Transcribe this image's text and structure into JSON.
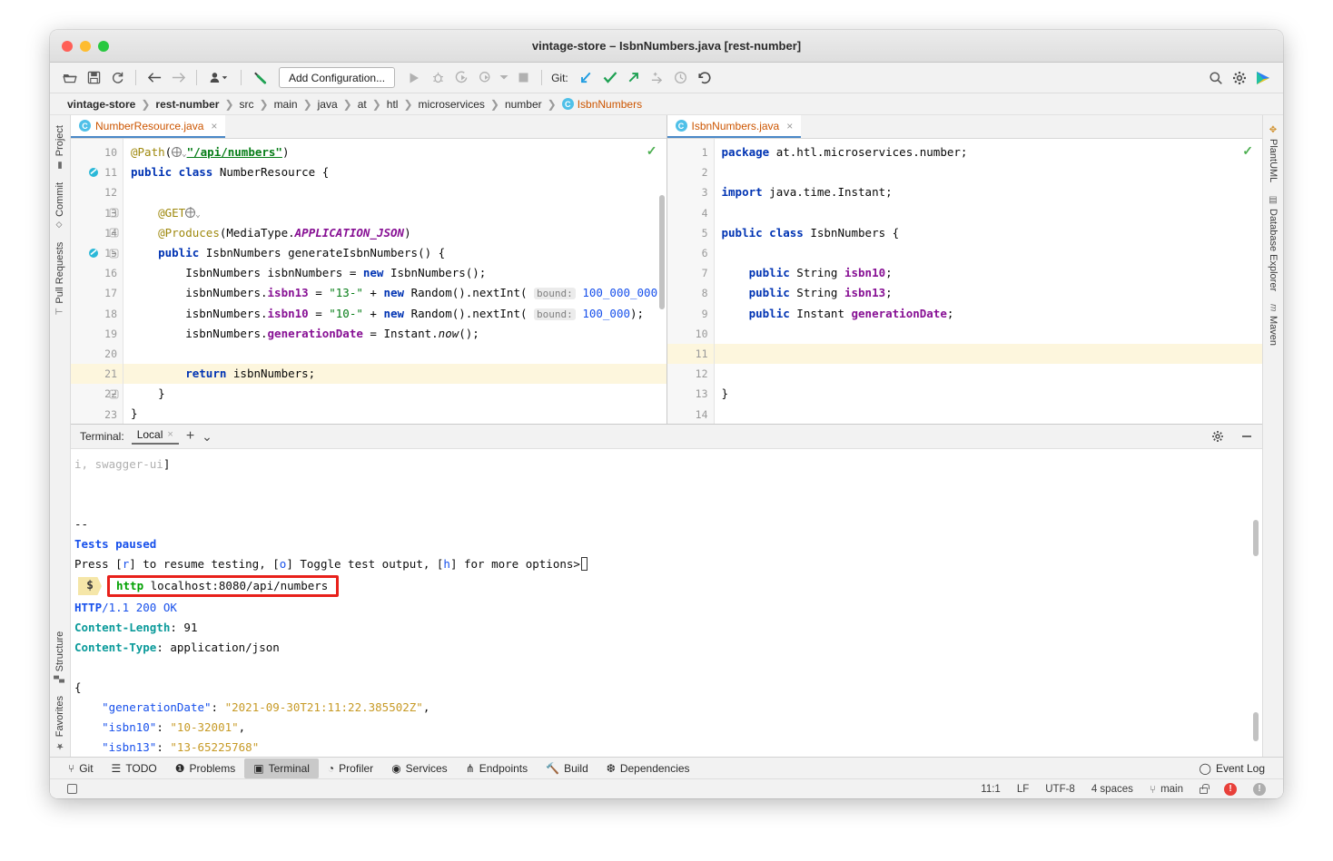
{
  "window": {
    "title": "vintage-store – IsbnNumbers.java [rest-number]"
  },
  "toolbar": {
    "add_configuration_label": "Add Configuration...",
    "git_label": "Git:",
    "icons": [
      "open-folder-icon",
      "save-icon",
      "sync-icon",
      "back-arrow-icon",
      "forward-arrow-icon",
      "profile-dropdown-icon",
      "build-hammer-icon"
    ],
    "run_icons": [
      "run-icon",
      "debug-icon",
      "run-coverage-icon",
      "profile-icon",
      "dropdown-icon",
      "stop-icon"
    ],
    "git_icons": [
      "update-project-icon",
      "commit-icon",
      "push-icon",
      "rebase-icon",
      "history-icon",
      "rollback-icon"
    ],
    "right_icons": [
      "search-icon",
      "gear-icon",
      "ide-logo-icon"
    ]
  },
  "breadcrumb": {
    "items": [
      {
        "label": "vintage-store",
        "bold": true
      },
      {
        "label": "rest-number",
        "bold": true
      },
      {
        "label": "src",
        "bold": false
      },
      {
        "label": "main",
        "bold": false
      },
      {
        "label": "java",
        "bold": false
      },
      {
        "label": "at",
        "bold": false
      },
      {
        "label": "htl",
        "bold": false
      },
      {
        "label": "microservices",
        "bold": false
      },
      {
        "label": "number",
        "bold": false
      }
    ],
    "current_class": "IsbnNumbers",
    "class_badge": "C"
  },
  "left_toolwindows": {
    "top": [
      "Project",
      "Commit",
      "Pull Requests"
    ],
    "bottom": [
      "Structure",
      "Favorites"
    ]
  },
  "right_toolwindows": {
    "items": [
      "PlantUML",
      "Database Explorer",
      "Maven"
    ]
  },
  "editor_left": {
    "tab": {
      "label": "NumberResource.java",
      "badge": "C",
      "close": "×"
    },
    "inspection_status": "✓",
    "first_line_number": 10,
    "highlighted_line": 21,
    "lines": [
      {
        "n": 10,
        "html": "<span class=\"ann\">@Path</span>(<span class=\"globe\"></span><span class=\"chev\">⌄</span><span class=\"strl\">\"/api/numbers\"</span>)"
      },
      {
        "n": 11,
        "html": "<span class=\"kw\">public class</span> NumberResource {"
      },
      {
        "n": 12,
        "html": ""
      },
      {
        "n": 13,
        "html": "    <span class=\"ann\">@GET</span><span class=\"globe\"></span><span class=\"chev\">⌄</span>"
      },
      {
        "n": 14,
        "html": "    <span class=\"ann\">@Produces</span>(MediaType.<span class=\"stat\">APPLICATION_JSON</span>)"
      },
      {
        "n": 15,
        "html": "    <span class=\"kw\">public</span> IsbnNumbers generateIsbnNumbers() {"
      },
      {
        "n": 16,
        "html": "        IsbnNumbers isbnNumbers = <span class=\"kw\">new</span> IsbnNumbers();"
      },
      {
        "n": 17,
        "html": "        isbnNumbers.<span class=\"fld\">isbn13</span> = <span class=\"str\">\"13-\"</span> + <span class=\"kw\">new</span> Random().nextInt( <span class=\"hint\">bound:</span> <span class=\"num\">100_000_000</span>);"
      },
      {
        "n": 18,
        "html": "        isbnNumbers.<span class=\"fld\">isbn10</span> = <span class=\"str\">\"10-\"</span> + <span class=\"kw\">new</span> Random().nextInt( <span class=\"hint\">bound:</span> <span class=\"num\">100_000</span>);"
      },
      {
        "n": 19,
        "html": "        isbnNumbers.<span class=\"fld\">generationDate</span> = Instant.<span class=\"ital\">now</span>();"
      },
      {
        "n": 20,
        "html": ""
      },
      {
        "n": 21,
        "html": "        <span class=\"kw\">return</span> isbnNumbers;"
      },
      {
        "n": 22,
        "html": "    }"
      },
      {
        "n": 23,
        "html": "}"
      }
    ],
    "gutter_marks": {
      "11": "bean-icon",
      "15": "endpoint-icon"
    },
    "folds": [
      13,
      14,
      15,
      22
    ]
  },
  "editor_right": {
    "tab": {
      "label": "IsbnNumbers.java",
      "badge": "C",
      "close": "×"
    },
    "inspection_status": "✓",
    "highlighted_line": 11,
    "lines": [
      {
        "n": 1,
        "html": "<span class=\"kw\">package</span> at.htl.microservices.number;"
      },
      {
        "n": 2,
        "html": ""
      },
      {
        "n": 3,
        "html": "<span class=\"kw\">import</span> java.time.Instant;"
      },
      {
        "n": 4,
        "html": ""
      },
      {
        "n": 5,
        "html": "<span class=\"kw\">public class</span> IsbnNumbers {"
      },
      {
        "n": 6,
        "html": ""
      },
      {
        "n": 7,
        "html": "    <span class=\"kw\">public</span> String <span class=\"fld\">isbn10</span>;"
      },
      {
        "n": 8,
        "html": "    <span class=\"kw\">public</span> String <span class=\"fld\">isbn13</span>;"
      },
      {
        "n": 9,
        "html": "    <span class=\"kw\">public</span> Instant <span class=\"fld\">generationDate</span>;"
      },
      {
        "n": 10,
        "html": ""
      },
      {
        "n": 11,
        "html": ""
      },
      {
        "n": 12,
        "html": ""
      },
      {
        "n": 13,
        "html": "}"
      },
      {
        "n": 14,
        "html": ""
      }
    ]
  },
  "terminal": {
    "label": "Terminal:",
    "tab": "Local",
    "tab_close": "×",
    "add_icon": "+",
    "dropdown_icon": "⌄",
    "settings_icon": "gear-icon",
    "minimize_icon": "minimize-icon",
    "command": "http localhost:8080/api/numbers",
    "prompt_symbol": "$",
    "lines": [
      {
        "cls": "t-gray",
        "text": "i, swagger-ui]",
        "suffix": "]"
      },
      {
        "cls": "plain",
        "text": ""
      },
      {
        "cls": "plain",
        "text": ""
      },
      {
        "cls": "plain",
        "text": "--"
      },
      {
        "cls": "t-blue-b",
        "text": "Tests paused"
      }
    ],
    "prompt_line_prefix": "Press [",
    "prompt_keys": [
      "r",
      "o",
      "h"
    ],
    "prompt_line_full": "Press [r] to resume testing, [o] Toggle test output, [h] for more options>",
    "response": {
      "status_proto": "HTTP",
      "status_rest": "/1.1 200 OK",
      "headers": [
        {
          "name": "Content-Length",
          "value": "91"
        },
        {
          "name": "Content-Type",
          "value": "application/json"
        }
      ],
      "json_open": "{",
      "json_close": "}",
      "json_fields": [
        {
          "key": "\"generationDate\"",
          "value": "\"2021-09-30T21:11:22.385502Z\"",
          "comma": ","
        },
        {
          "key": "\"isbn10\"",
          "value": "\"10-32001\"",
          "comma": ","
        },
        {
          "key": "\"isbn13\"",
          "value": "\"13-65225768\"",
          "comma": ""
        }
      ]
    }
  },
  "statusbar": {
    "tools": [
      {
        "label": "Git",
        "icon": "git-branch-icon",
        "active": false
      },
      {
        "label": "TODO",
        "icon": "list-icon",
        "active": false
      },
      {
        "label": "Problems",
        "icon": "warning-icon",
        "active": false
      },
      {
        "label": "Terminal",
        "icon": "terminal-icon",
        "active": true
      },
      {
        "label": "Profiler",
        "icon": "profiler-icon",
        "active": false
      },
      {
        "label": "Services",
        "icon": "services-icon",
        "active": false
      },
      {
        "label": "Endpoints",
        "icon": "endpoints-icon",
        "active": false
      },
      {
        "label": "Build",
        "icon": "hammer-icon",
        "active": false
      },
      {
        "label": "Dependencies",
        "icon": "layers-icon",
        "active": false
      }
    ],
    "event_log": "Event Log",
    "event_log_icon": "balloon-icon",
    "caret_position": "11:1",
    "line_separator": "LF",
    "encoding": "UTF-8",
    "indent": "4 spaces",
    "branch": "main",
    "lock_icon": "lock-icon",
    "error_badge_icon": "error-icon",
    "inspection_badge_icon": "inspection-icon"
  },
  "colors": {
    "accent_blue": "#4a88c7",
    "tab_orange": "#cc5500",
    "highlight_yellow": "#fdf6dd",
    "red_annotation": "#e8201a",
    "green_check": "#4caf50"
  }
}
